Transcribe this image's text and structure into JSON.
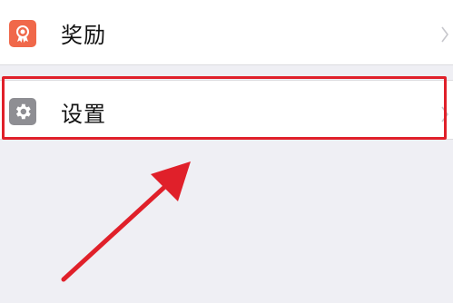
{
  "menu": {
    "items": [
      {
        "label": "奖励",
        "icon": "award-icon",
        "icon_color": "#f0684a"
      },
      {
        "label": "设置",
        "icon": "gear-icon",
        "icon_color": "#8e8e93"
      }
    ]
  },
  "annotation": {
    "highlight_color": "#e0202a",
    "arrow_color": "#e0202a"
  }
}
